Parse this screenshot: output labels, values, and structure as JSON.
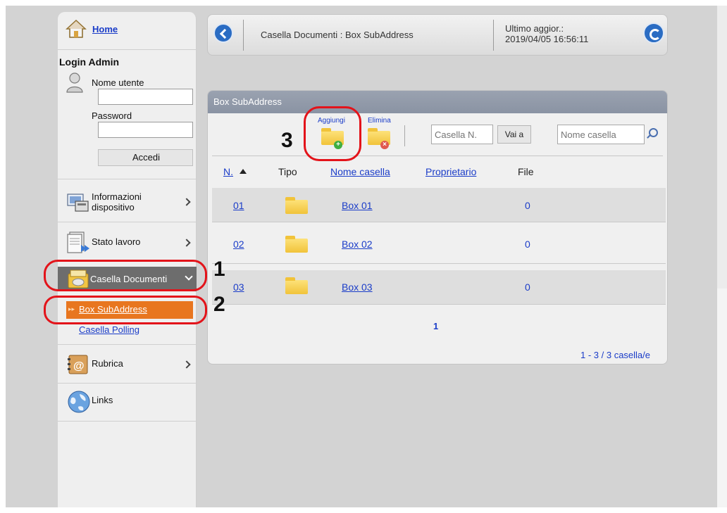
{
  "sidebar": {
    "home": "Home",
    "login_title": "Login Admin",
    "username_label": "Nome utente",
    "username_value": "",
    "password_label": "Password",
    "password_value": "",
    "login_button": "Accedi",
    "items": [
      {
        "label_line1": "Informazioni",
        "label_line2": "dispositivo",
        "icon": "device-info-icon"
      },
      {
        "label": "Stato lavoro",
        "icon": "job-status-icon"
      },
      {
        "label": "Casella Documenti",
        "icon": "document-box-icon"
      },
      {
        "label": "Rubrica",
        "icon": "address-book-icon"
      },
      {
        "label": "Links",
        "icon": "globe-icon"
      }
    ],
    "subitems": [
      {
        "label": "Box SubAddress"
      },
      {
        "label": "Casella Polling"
      }
    ]
  },
  "header": {
    "title": "Casella Documenti : Box SubAddress",
    "updated_label": "Ultimo aggior.:",
    "updated_value": "2019/04/05 16:56:11"
  },
  "panel": {
    "title": "Box SubAddress",
    "add_label": "Aggiungi",
    "delete_label": "Elimina",
    "box_number_placeholder": "Casella N.",
    "go_button": "Vai a",
    "box_name_placeholder": "Nome casella",
    "columns": [
      "N.",
      "Tipo",
      "Nome casella",
      "Proprietario",
      "File"
    ],
    "rows": [
      {
        "number": "01",
        "name": "Box 01",
        "owner": "",
        "files": "0"
      },
      {
        "number": "02",
        "name": "Box 02",
        "owner": "",
        "files": "0"
      },
      {
        "number": "03",
        "name": "Box 03",
        "owner": "",
        "files": "0"
      }
    ],
    "page": "1",
    "count": "1 - 3 / 3 casella/e"
  },
  "annotations": {
    "step1": "1",
    "step2": "2",
    "step3": "3"
  },
  "colors": {
    "active_nav": "#6d6d6d",
    "active_sub": "#e8761f",
    "link": "#1a3cc8",
    "annotation": "#e3131a"
  }
}
